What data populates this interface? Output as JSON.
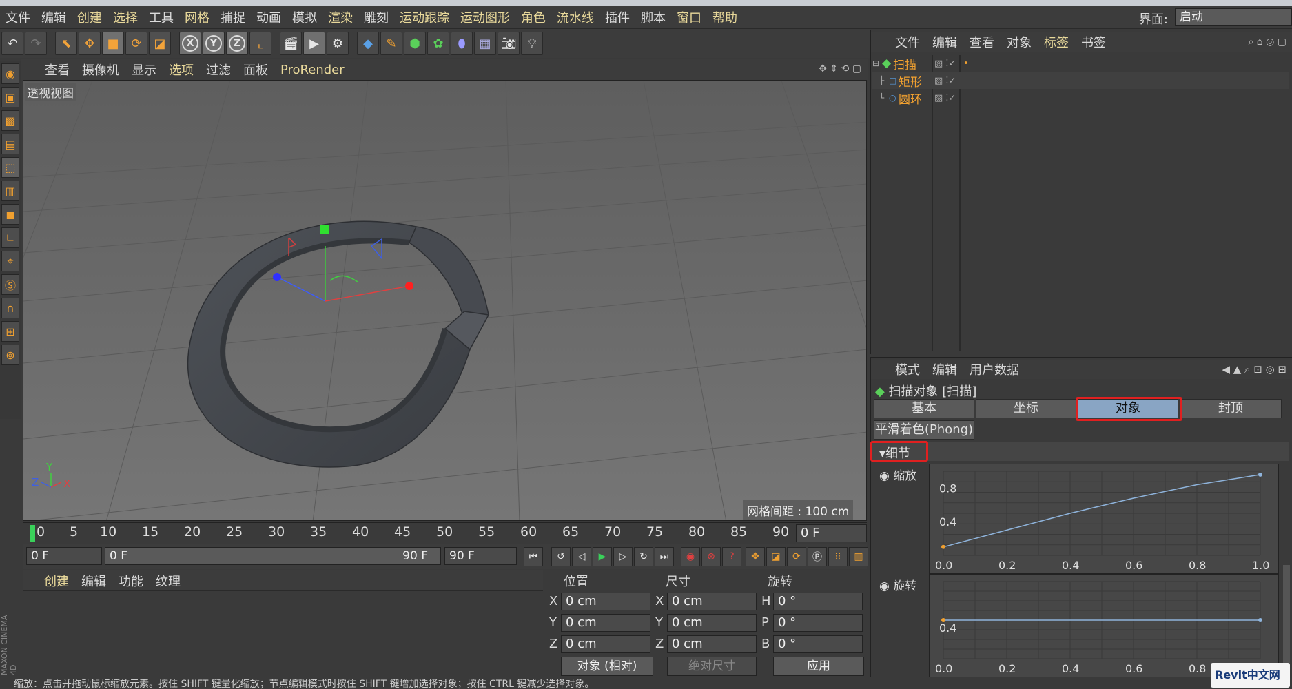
{
  "menubar": {
    "items": [
      "文件",
      "编辑",
      "创建",
      "选择",
      "工具",
      "网格",
      "捕捉",
      "动画",
      "模拟",
      "渲染",
      "雕刻",
      "运动跟踪",
      "运动图形",
      "角色",
      "流水线",
      "插件",
      "脚本",
      "窗口",
      "帮助"
    ],
    "interface_label": "界面:",
    "interface_value": "启动"
  },
  "viewport": {
    "menu": [
      "查看",
      "摄像机",
      "显示",
      "选项",
      "过滤",
      "面板",
      "ProRender"
    ],
    "label": "透视视图",
    "grid_spacing": "网格间距 : 100 cm",
    "axis_x": "X",
    "axis_y": "Y",
    "axis_z": "Z"
  },
  "timeline": {
    "ticks": [
      "0",
      "5",
      "10",
      "15",
      "20",
      "25",
      "30",
      "35",
      "40",
      "45",
      "50",
      "55",
      "60",
      "65",
      "70",
      "75",
      "80",
      "85",
      "90"
    ],
    "current_frame": "0 F"
  },
  "playbar": {
    "start_field": "0 F",
    "range_start": "0 F",
    "range_end": "90 F",
    "end_field": "90 F"
  },
  "material": {
    "menu": [
      "创建",
      "编辑",
      "功能",
      "纹理"
    ]
  },
  "coords": {
    "heads": [
      "位置",
      "尺寸",
      "旋转"
    ],
    "pos": [
      {
        "axis": "X",
        "value": "0 cm"
      },
      {
        "axis": "Y",
        "value": "0 cm"
      },
      {
        "axis": "Z",
        "value": "0 cm"
      }
    ],
    "size": [
      {
        "axis": "X",
        "value": "0 cm"
      },
      {
        "axis": "Y",
        "value": "0 cm"
      },
      {
        "axis": "Z",
        "value": "0 cm"
      }
    ],
    "rot": [
      {
        "axis": "H",
        "value": "0 °"
      },
      {
        "axis": "P",
        "value": "0 °"
      },
      {
        "axis": "B",
        "value": "0 °"
      }
    ],
    "mode_select": "对象 (相对)",
    "size_select": "绝对尺寸",
    "apply": "应用"
  },
  "objects": {
    "menu": [
      "文件",
      "编辑",
      "查看",
      "对象",
      "标签",
      "书签"
    ],
    "rows": [
      {
        "name": "扫描"
      },
      {
        "name": "矩形"
      },
      {
        "name": "圆环"
      }
    ]
  },
  "attributes": {
    "menu": [
      "模式",
      "编辑",
      "用户数据"
    ],
    "title": "扫描对象 [扫描]",
    "tabs": [
      "基本",
      "坐标",
      "对象",
      "封顶"
    ],
    "subtab": "平滑着色(Phong)",
    "section": "细节",
    "scale_label": "缩放",
    "rotate_label": "旋转",
    "yticks": [
      "0.8",
      "0.4"
    ],
    "xticks": [
      "0.0",
      "0.2",
      "0.4",
      "0.6",
      "0.8",
      "1.0"
    ],
    "scale_curve": [
      [
        0.0,
        0.1
      ],
      [
        0.2,
        0.3
      ],
      [
        0.4,
        0.5
      ],
      [
        0.6,
        0.68
      ],
      [
        0.8,
        0.84
      ],
      [
        1.0,
        0.96
      ]
    ],
    "rotate_curve": [
      [
        0.0,
        0.5
      ],
      [
        1.0,
        0.5
      ]
    ]
  },
  "statusbar": {
    "text": "缩放：点击并拖动鼠标缩放元素。按住 SHIFT 键量化缩放；节点编辑模式时按住 SHIFT 键增加选择对象；按住 CTRL 键减少选择对象。"
  },
  "watermark": {
    "text": "Revit中文网"
  }
}
